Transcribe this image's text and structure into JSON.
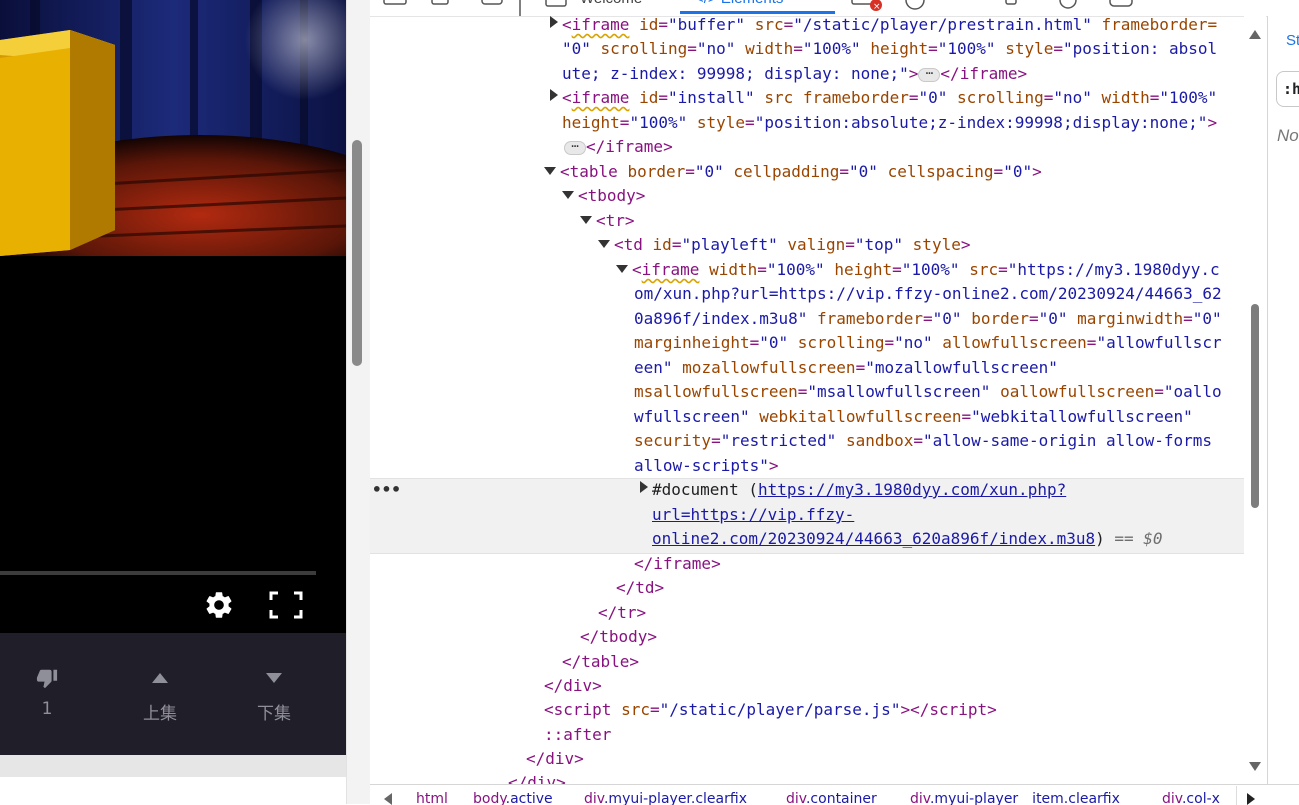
{
  "player": {
    "dislike_count": "1",
    "prev_label": "上集",
    "next_label": "下集"
  },
  "devtools": {
    "tabs": [
      "Welcome",
      "Elements"
    ],
    "styles_tab": "St",
    "styles_filter": ":h",
    "styles_no_match": "No",
    "dom": {
      "l1": {
        "id": "buffer",
        "src": "/static/player/prestrain.html",
        "frameborder_a": "frameborder=",
        "frameborder_b": "\"0\"",
        "scrolling": "\"no\"",
        "width": "\"100%\"",
        "height": "\"100%\"",
        "style_a": "\"position: absol",
        "style_b": "ute; z-index: 99998; display: none;\""
      },
      "l2": {
        "id": "install",
        "frameborder": "\"0\"",
        "scrolling": "\"no\"",
        "width": "\"100%\"",
        "height": "\"100%\"",
        "style": "\"position:absolute;z-index:99998;display:none;\""
      },
      "table_attrs": {
        "border": "\"0\"",
        "cellpadding": "\"0\"",
        "cellspacing": "\"0\""
      },
      "td": {
        "id": "\"playleft\"",
        "valign": "\"top\""
      },
      "iframe_src_1": "\"https://my3.1980dyy.c",
      "iframe_src_2": "om/xun.php?url=https://vip.ffzy-online2.com/20230924/44663_62",
      "iframe_src_3": "0a896f/index.m3u8\"",
      "iframe_attr_vals": {
        "width": "\"100%\"",
        "height": "\"100%\"",
        "frameborder": "\"0\"",
        "border": "\"0\"",
        "marginwidth": "\"0\"",
        "marginheight": "\"0\"",
        "scrolling": "\"no\"",
        "allowfullscreen_a": "\"allowfullscr",
        "allowfullscreen_b": "een\"",
        "mozallowfullscreen": "\"mozallowfullscreen\"",
        "msallowfullscreen": "\"msallowfullscreen\"",
        "oallowfullscreen_a": "\"oallo",
        "oallowfullscreen_b": "wfullscreen\"",
        "webkitallowfullscreen": "\"webkitallowfullscreen\"",
        "security": "\"restricted\"",
        "sandbox_a": "\"allow-same-origin allow-forms",
        "sandbox_b": "allow-scripts\""
      },
      "document_label": "#document",
      "document_url_1": "https://my3.1980dyy.com/xun.php?",
      "document_url_2": "url=https://vip.ffzy-",
      "document_url_3": "online2.com/20230924/44663_620a896f/index.m3u8",
      "selected_marker": "== $0",
      "script_src": "\"/static/player/parse.js\"",
      "after_pseudo": "::after"
    },
    "breadcrumbs": [
      {
        "tag": "html",
        "cls": ""
      },
      {
        "tag": "body",
        "cls": ".active"
      },
      {
        "tag": "div",
        "cls": ".myui-player.clearfix"
      },
      {
        "tag": "div",
        "cls": ".container"
      },
      {
        "tag": "div",
        "cls": ".myui-player__item.clearfix"
      },
      {
        "tag": "div",
        "cls": ".col-x"
      }
    ]
  }
}
